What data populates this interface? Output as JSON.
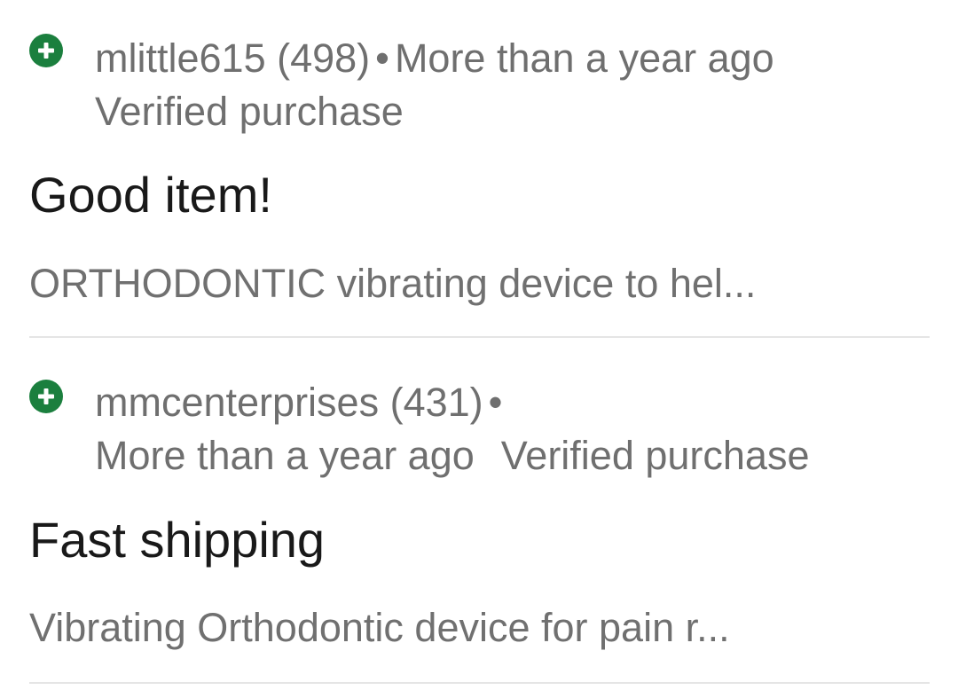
{
  "colors": {
    "positive_icon": "#1b7f3e",
    "meta_text": "#6f6f6f",
    "title_text": "#191919",
    "excerpt_text": "#707070",
    "divider": "#e5e5e5"
  },
  "reviews": [
    {
      "icon": "positive-feedback-plus-icon",
      "username": "mlittle615",
      "score": "(498)",
      "separator": "•",
      "time": "More than a year ago",
      "verified": "Verified purchase",
      "title": "Good item!",
      "excerpt": "ORTHODONTIC vibrating device to hel..."
    },
    {
      "icon": "positive-feedback-plus-icon",
      "username": "mmcenterprises",
      "score": "(431)",
      "separator": "•",
      "time": "More than a year ago",
      "verified": "Verified purchase",
      "title": "Fast shipping",
      "excerpt": "Vibrating Orthodontic device for pain r..."
    }
  ]
}
